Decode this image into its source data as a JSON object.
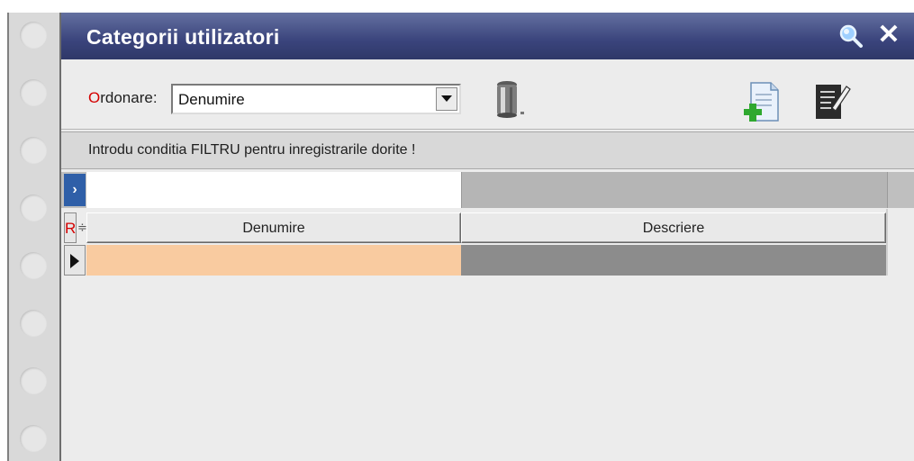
{
  "window": {
    "title": "Categorii utilizatori"
  },
  "toolbar": {
    "order_label_hotkey": "O",
    "order_label_rest": "rdonare:",
    "order_value": "Denumire"
  },
  "filter": {
    "label": "Introdu conditia FILTRU pentru inregistrarile dorite !",
    "marker": "›",
    "value": ""
  },
  "grid": {
    "header_marker": "R",
    "sort_glyph": "≑",
    "columns": [
      {
        "label": "Denumire"
      },
      {
        "label": "Descriere"
      }
    ],
    "rows": [
      {
        "denumire": "",
        "descriere": ""
      }
    ]
  },
  "colors": {
    "titlebar": "#3a447c",
    "selected_cell": "#f9cba0",
    "hotkey": "#d40000"
  },
  "icons": {
    "search": "magnifier-icon",
    "close": "close-icon",
    "delete": "trash-can-icon",
    "add": "add-document-icon",
    "edit": "edit-document-icon"
  }
}
